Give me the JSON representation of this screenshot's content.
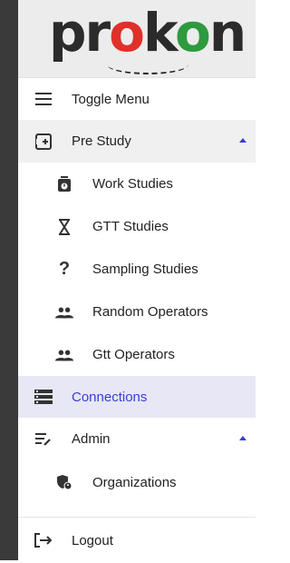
{
  "logo": {
    "text": "prokon"
  },
  "menu": {
    "toggle": {
      "label": "Toggle Menu",
      "icon": "menu-icon"
    },
    "pre_study": {
      "label": "Pre Study",
      "icon": "pre-study-icon",
      "expanded": true,
      "children": [
        {
          "label": "Work Studies",
          "icon": "stopwatch-icon"
        },
        {
          "label": "GTT Studies",
          "icon": "hourglass-icon"
        },
        {
          "label": "Sampling Studies",
          "icon": "question-icon"
        },
        {
          "label": "Random Operators",
          "icon": "people-icon"
        },
        {
          "label": "Gtt Operators",
          "icon": "people-icon"
        }
      ]
    },
    "connections": {
      "label": "Connections",
      "icon": "connections-icon",
      "active": true
    },
    "admin": {
      "label": "Admin",
      "icon": "admin-icon",
      "expanded": true,
      "children": [
        {
          "label": "Organizations",
          "icon": "organization-icon"
        }
      ]
    },
    "logout": {
      "label": "Logout",
      "icon": "logout-icon"
    }
  },
  "colors": {
    "accent": "#3b3bd6",
    "active_bg": "#e7e7f6",
    "section_bg": "#f0f0f0",
    "rail": "#3a3a3a"
  }
}
